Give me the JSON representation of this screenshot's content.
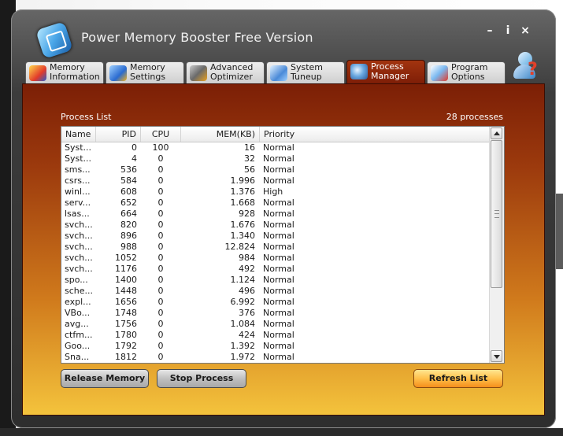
{
  "window": {
    "title": "Power Memory Booster Free Version",
    "buttons": {
      "minimize": "–",
      "info": "i",
      "close": "×"
    }
  },
  "tabs": [
    {
      "label": "Memory\nInformation",
      "icon": "memory-info-icon",
      "active": false
    },
    {
      "label": "Memory\nSettings",
      "icon": "memory-settings-icon",
      "active": false
    },
    {
      "label": "Advanced\nOptimizer",
      "icon": "optimizer-icon",
      "active": false
    },
    {
      "label": "System\nTuneup",
      "icon": "system-tuneup-icon",
      "active": false
    },
    {
      "label": "Process\nManager",
      "icon": "gears-icon",
      "active": true
    },
    {
      "label": "Program\nOptions",
      "icon": "program-options-icon",
      "active": false
    }
  ],
  "process_list": {
    "title": "Process List",
    "count_label": "28 processes",
    "columns": [
      "Name",
      "PID",
      "CPU",
      "MEM(KB)",
      "Priority"
    ],
    "rows": [
      [
        "Syst...",
        "0",
        "100",
        "16",
        "Normal"
      ],
      [
        "Syst...",
        "4",
        "0",
        "32",
        "Normal"
      ],
      [
        "sms...",
        "536",
        "0",
        "56",
        "Normal"
      ],
      [
        "csrs...",
        "584",
        "0",
        "1.996",
        "Normal"
      ],
      [
        "winl...",
        "608",
        "0",
        "1.376",
        "High"
      ],
      [
        "serv...",
        "652",
        "0",
        "1.668",
        "Normal"
      ],
      [
        "lsas...",
        "664",
        "0",
        "928",
        "Normal"
      ],
      [
        "svch...",
        "820",
        "0",
        "1.676",
        "Normal"
      ],
      [
        "svch...",
        "896",
        "0",
        "1.340",
        "Normal"
      ],
      [
        "svch...",
        "988",
        "0",
        "12.824",
        "Normal"
      ],
      [
        "svch...",
        "1052",
        "0",
        "984",
        "Normal"
      ],
      [
        "svch...",
        "1176",
        "0",
        "492",
        "Normal"
      ],
      [
        "spo...",
        "1400",
        "0",
        "1.124",
        "Normal"
      ],
      [
        "sche...",
        "1448",
        "0",
        "496",
        "Normal"
      ],
      [
        "expl...",
        "1656",
        "0",
        "6.992",
        "Normal"
      ],
      [
        "VBo...",
        "1748",
        "0",
        "376",
        "Normal"
      ],
      [
        "avg...",
        "1756",
        "0",
        "1.084",
        "Normal"
      ],
      [
        "ctfm...",
        "1780",
        "0",
        "424",
        "Normal"
      ],
      [
        "Goo...",
        "1792",
        "0",
        "1.392",
        "Normal"
      ],
      [
        "Sna...",
        "1812",
        "0",
        "1.972",
        "Normal"
      ]
    ]
  },
  "actions": {
    "release_memory": "Release Memory",
    "stop_process": "Stop Process",
    "refresh_list": "Refresh List"
  },
  "colors": {
    "accent_dark": "#7c1f06",
    "accent_light": "#f4c33c",
    "refresh_button": "#ffc04a"
  }
}
